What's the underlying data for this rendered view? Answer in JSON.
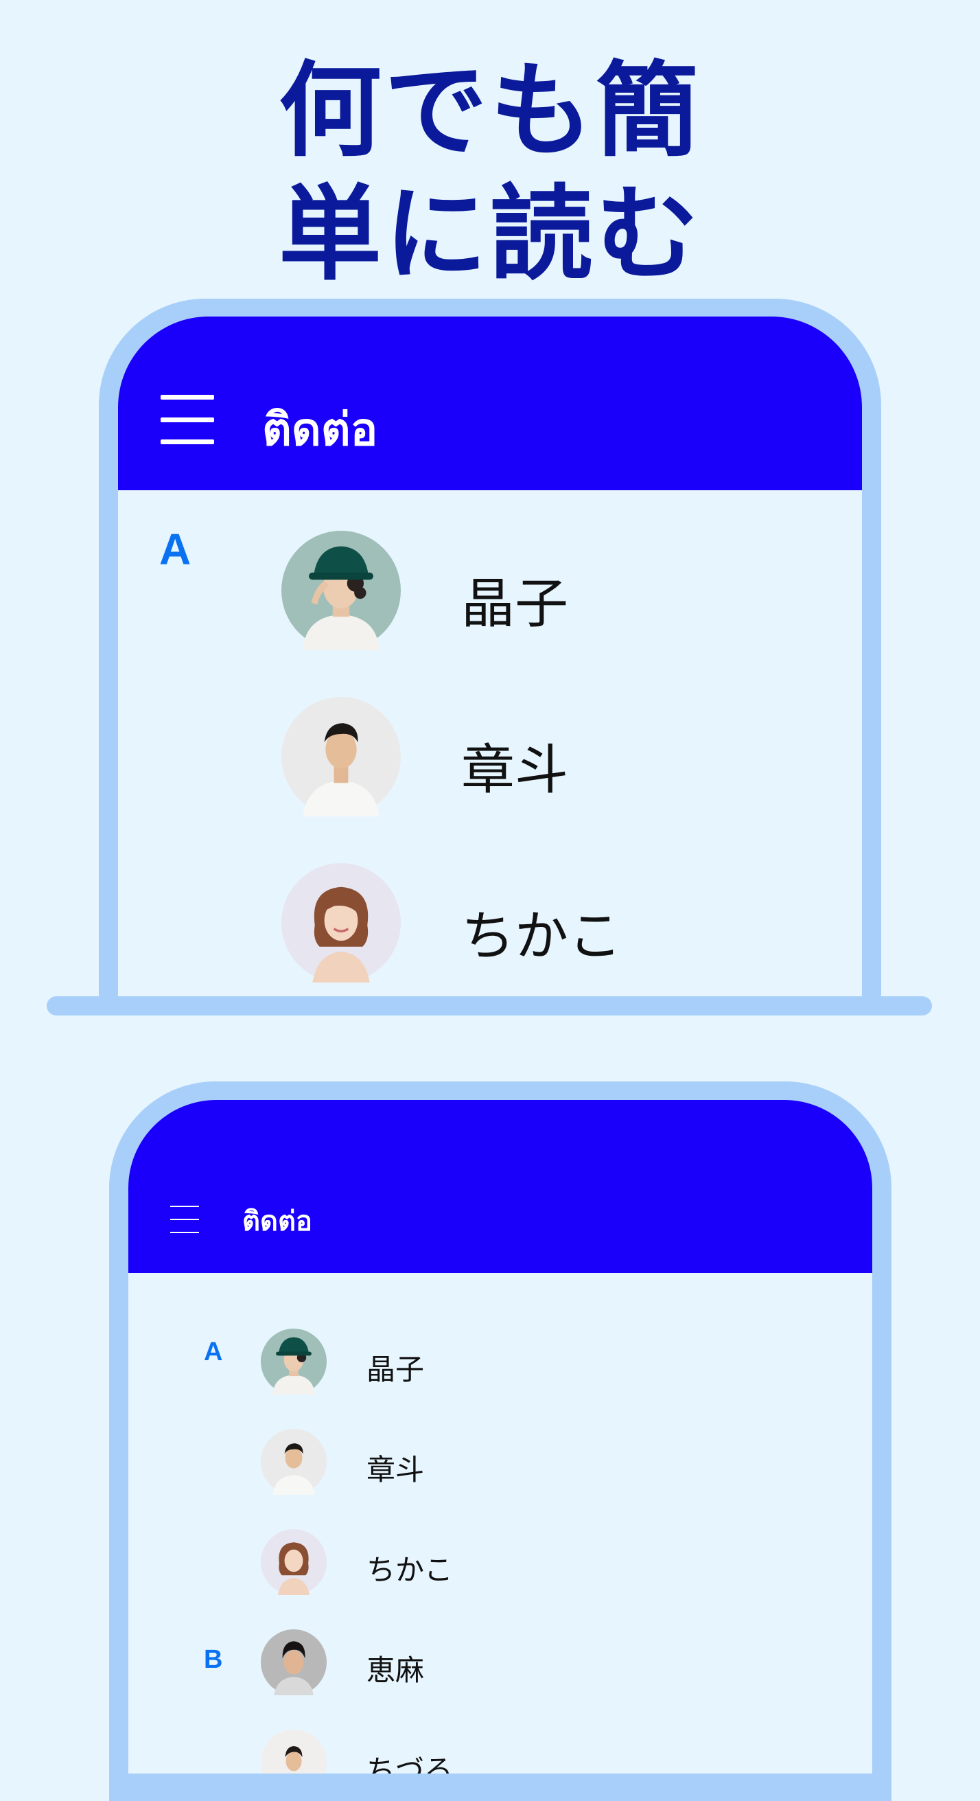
{
  "headline": {
    "line1": "何でも簡",
    "line2": "単に読む"
  },
  "colors": {
    "background": "#e7f5fe",
    "header": "#1a00fa",
    "frame": "#a8cff9",
    "section_letter": "#0a72f0",
    "headline": "#0a1a9a"
  },
  "phone1": {
    "header": {
      "menu_icon": "hamburger-menu-icon",
      "title": "ติดต่อ"
    },
    "section": "A",
    "contacts": [
      {
        "name": "晶子",
        "avatar": "avatar-photo-bucket-hat"
      },
      {
        "name": "章斗",
        "avatar": "avatar-photo-man"
      },
      {
        "name": "ちかこ",
        "avatar": "avatar-photo-woman"
      }
    ]
  },
  "phone2": {
    "header": {
      "menu_icon": "hamburger-menu-icon",
      "title": "ติดต่อ"
    },
    "sections": [
      {
        "letter": "A"
      },
      {
        "letter": "B"
      }
    ],
    "contacts": [
      {
        "name": "晶子",
        "avatar": "avatar-photo-bucket-hat"
      },
      {
        "name": "章斗",
        "avatar": "avatar-photo-man"
      },
      {
        "name": "ちかこ",
        "avatar": "avatar-photo-woman"
      },
      {
        "name": "恵麻",
        "avatar": "avatar-photo-man-dark"
      },
      {
        "name": "ちづる",
        "avatar": "avatar-photo-man-light"
      }
    ]
  }
}
